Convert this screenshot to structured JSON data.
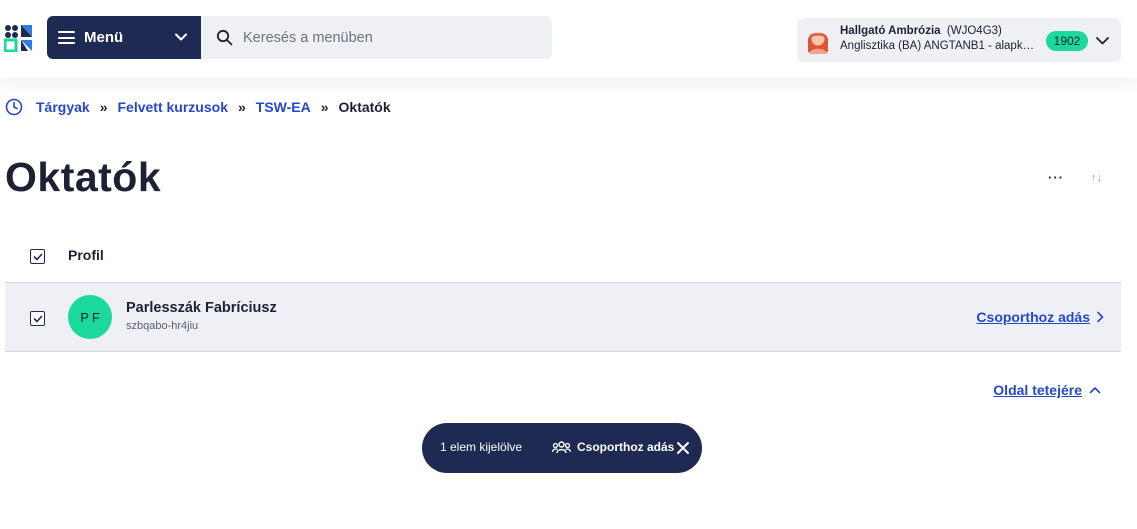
{
  "header": {
    "menu_label": "Menü",
    "search_placeholder": "Keresés a menüben",
    "user": {
      "name": "Hallgató Ambrózia",
      "code": "(WJO4G3)",
      "program": "Anglisztika (BA) ANGTANB1 - alapképzés",
      "badge": "1902"
    }
  },
  "breadcrumb": {
    "items": [
      "Tárgyak",
      "Felvett kurzusok",
      "TSW-EA"
    ],
    "separator": "»",
    "current": "Oktatók"
  },
  "page": {
    "title": "Oktatók",
    "more": "···",
    "sort": "↑↓"
  },
  "table": {
    "header": "Profil",
    "rows": [
      {
        "initials": "PF",
        "name": "Parlesszák Fabríciusz",
        "username": "szbqabo-hr4jiu",
        "action": "Csoporthoz adás",
        "checked": true
      }
    ]
  },
  "back_to_top": "Oldal tetejére",
  "selection_bar": {
    "count_text": "1 elem kijelölve",
    "action": "Csoporthoz adás"
  },
  "colors": {
    "navy": "#1e2a52",
    "link": "#2548c9",
    "accent_green": "#1ad99a"
  }
}
